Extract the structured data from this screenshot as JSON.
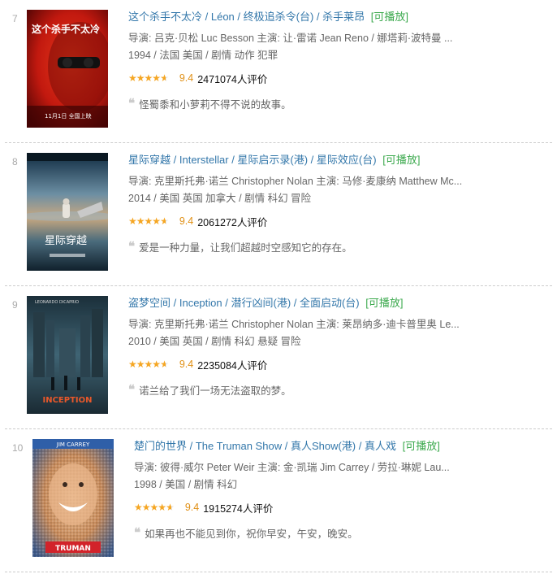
{
  "movies": [
    {
      "rank": "7",
      "title": "这个杀手不太冷",
      "title_other": "/ Léon",
      "title_alt": "/ 终极追杀令(台) / 杀手莱昂",
      "playable": "[可播放]",
      "credits": "导演: 吕克·贝松 Luc Besson   主演: 让·雷诺 Jean Reno / 娜塔莉·波特曼 ...",
      "meta": "1994 / 法国 美国 / 剧情 动作 犯罪",
      "rating": "9.4",
      "rating_value": 9.4,
      "votes": "2471074人评价",
      "quote": "怪蜀黍和小萝莉不得不说的故事。",
      "poster_text_main": "这个杀手不太冷",
      "poster_text_date": "11月1日  全国上映"
    },
    {
      "rank": "8",
      "title": "星际穿越",
      "title_other": "/ Interstellar",
      "title_alt": "/ 星际启示录(港) / 星际效应(台)",
      "playable": "[可播放]",
      "credits": "导演: 克里斯托弗·诺兰 Christopher Nolan   主演: 马修·麦康纳 Matthew Mc...",
      "meta": "2014 / 美国 英国 加拿大 / 剧情 科幻 冒险",
      "rating": "9.4",
      "rating_value": 9.4,
      "votes": "2061272人评价",
      "quote": "爱是一种力量，让我们超越时空感知它的存在。",
      "poster_text_main": "星际穿越"
    },
    {
      "rank": "9",
      "title": "盗梦空间",
      "title_other": "/ Inception",
      "title_alt": "/ 潜行凶间(港) / 全面启动(台)",
      "playable": "[可播放]",
      "credits": "导演: 克里斯托弗·诺兰 Christopher Nolan   主演: 莱昂纳多·迪卡普里奥 Le...",
      "meta": "2010 / 美国 英国 / 剧情 科幻 悬疑 冒险",
      "rating": "9.4",
      "rating_value": 9.4,
      "votes": "2235084人评价",
      "quote": "诺兰给了我们一场无法盗取的梦。",
      "poster_text_main": "INCEPTION",
      "poster_text_top": "LEONARDO DICAPRIO"
    },
    {
      "rank": "10",
      "title": "楚门的世界",
      "title_other": "/ The Truman Show",
      "title_alt": "/ 真人Show(港) / 真人戏",
      "playable": "[可播放]",
      "credits": "导演: 彼得·威尔 Peter Weir   主演: 金·凯瑞 Jim Carrey / 劳拉·琳妮 Lau...",
      "meta": "1998 / 美国 / 剧情 科幻",
      "rating": "9.4",
      "rating_value": 9.4,
      "votes": "1915274人评价",
      "quote": "如果再也不能见到你，祝你早安，午安，晚安。",
      "poster_text_top": "JIM CARREY",
      "poster_text_main": "TRUMAN"
    }
  ],
  "colors": {
    "title_link": "#3377aa",
    "playable": "#3ba94d",
    "rating_num": "#e09015",
    "star": "#f5a623"
  },
  "icons": {
    "quote": "quote-mark-icon",
    "star": "star-icon"
  }
}
